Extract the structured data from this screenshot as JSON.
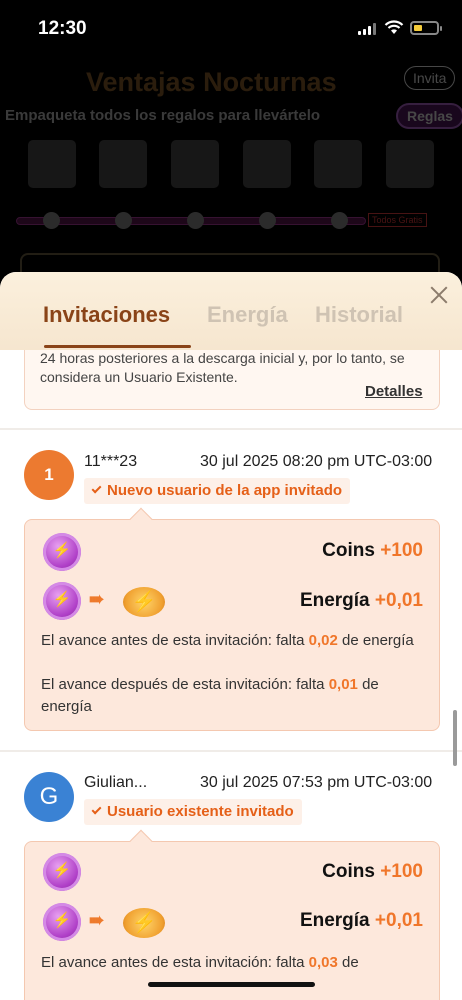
{
  "status": {
    "time": "12:30"
  },
  "background_page": {
    "title": "Ventajas Nocturnas",
    "invite_label": "Invita",
    "subtitle": "Empaqueta todos los regalos para llevártelo",
    "rules_label": "Reglas",
    "all_free_label": "Todos Gratis"
  },
  "sheet": {
    "tabs": [
      {
        "label": "Invitaciones",
        "active": true
      },
      {
        "label": "Energía",
        "active": false
      },
      {
        "label": "Historial",
        "active": false
      }
    ],
    "note": {
      "text": "24 horas posteriores a la descarga inicial y, por lo tanto, se considera un Usuario Existente.",
      "link": "Detalles"
    },
    "invitations": [
      {
        "avatar": "1",
        "name": "11***23",
        "date": "30 jul 2025 08:20 pm UTC-03:00",
        "tag": "Nuevo usuario de la app invitado",
        "coins_label": "Coins",
        "coins_value": "+100",
        "energy_label": "Energía",
        "energy_value": "+0,01",
        "before_prefix": "El avance antes de esta invitación: falta",
        "before_value": "0,02",
        "before_suffix": "de energía",
        "after_prefix": "El avance después de esta invitación: falta",
        "after_value": "0,01",
        "after_suffix": "de energía"
      },
      {
        "avatar": "G",
        "name": "Giulian...",
        "date": "30 jul 2025 07:53 pm UTC-03:00",
        "tag": "Usuario existente invitado",
        "coins_label": "Coins",
        "coins_value": "+100",
        "energy_label": "Energía",
        "energy_value": "+0,01",
        "before_prefix": "El avance antes de esta invitación: falta",
        "before_value": "0,03",
        "before_suffix": "de"
      }
    ]
  },
  "colors": {
    "accent_orange": "#f0762a",
    "tab_active": "#8a4418",
    "card_bg": "#fde8dc"
  }
}
